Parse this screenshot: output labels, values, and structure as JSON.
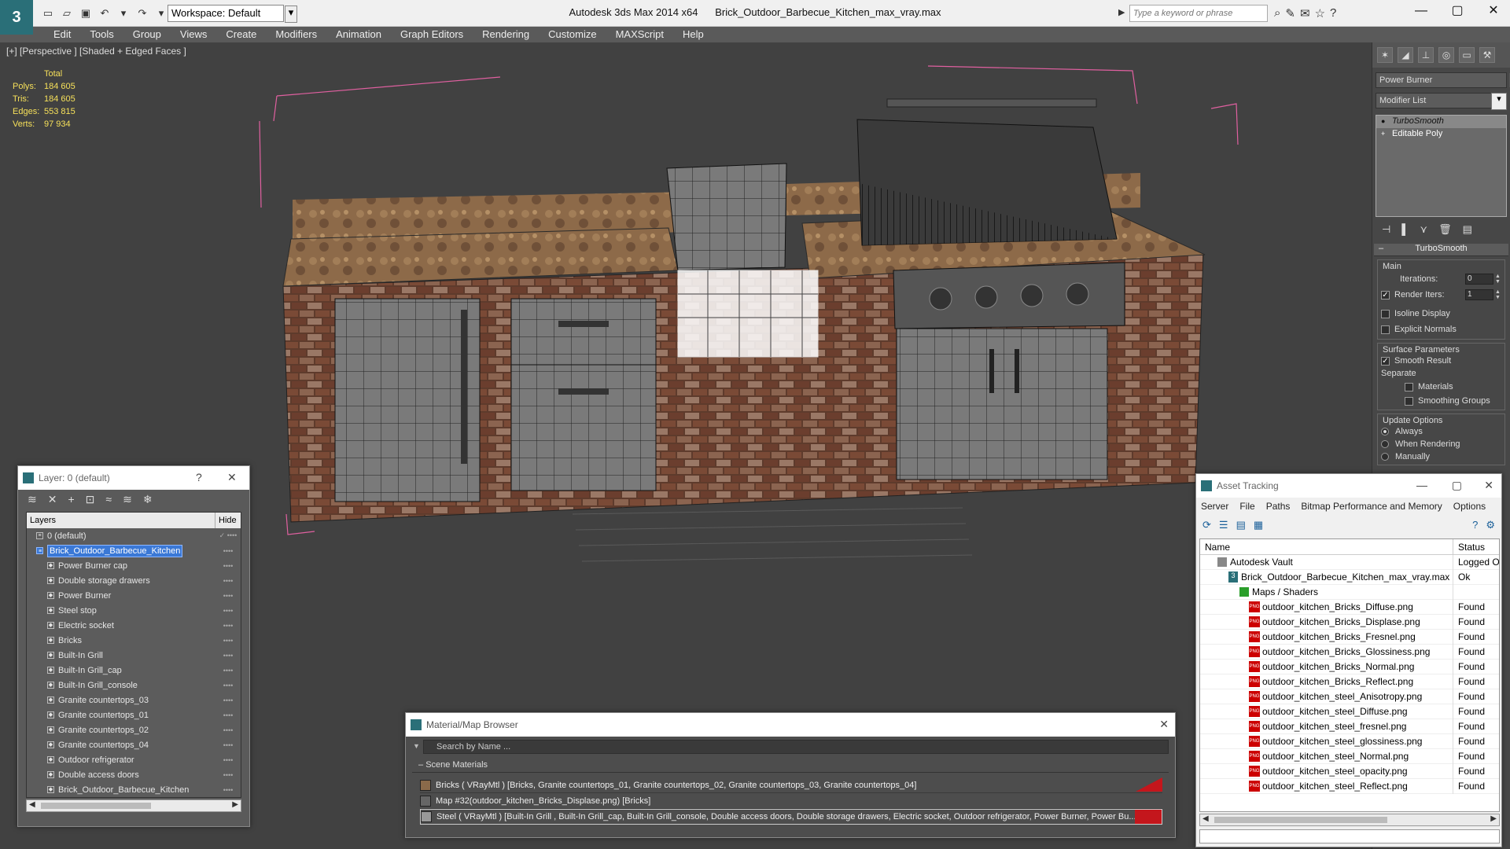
{
  "titlebar": {
    "logo": "3",
    "workspace": "Workspace: Default",
    "app_name": "Autodesk 3ds Max  2014 x64",
    "file_name": "Brick_Outdoor_Barbecue_Kitchen_max_vray.max",
    "search_placeholder": "Type a keyword or phrase"
  },
  "menu": [
    "Edit",
    "Tools",
    "Group",
    "Views",
    "Create",
    "Modifiers",
    "Animation",
    "Graph Editors",
    "Rendering",
    "Customize",
    "MAXScript",
    "Help"
  ],
  "viewport": {
    "label": "[+] [Perspective ] [Shaded + Edged Faces ]",
    "stats": {
      "header": "Total",
      "polys_label": "Polys:",
      "polys": "184 605",
      "tris_label": "Tris:",
      "tris": "184 605",
      "edges_label": "Edges:",
      "edges": "553 815",
      "verts_label": "Verts:",
      "verts": "97 934"
    }
  },
  "command_panel": {
    "object_name": "Power Burner",
    "modifier_list": "Modifier List",
    "stack": [
      "TurboSmooth",
      "Editable Poly"
    ],
    "rollout_title": "TurboSmooth",
    "main_label": "Main",
    "iterations_label": "Iterations:",
    "iterations": "0",
    "render_iters_label": "Render Iters:",
    "render_iters": "1",
    "isoline": "Isoline Display",
    "explicit_normals": "Explicit Normals",
    "surface_params": "Surface Parameters",
    "smooth_result": "Smooth Result",
    "separate": "Separate",
    "materials": "Materials",
    "smoothing_groups": "Smoothing Groups",
    "update_options": "Update Options",
    "always": "Always",
    "when_rendering": "When Rendering",
    "manually": "Manually"
  },
  "layer_window": {
    "title": "Layer: 0 (default)",
    "help": "?",
    "close": "✕",
    "col_layers": "Layers",
    "col_hide": "Hide",
    "rows": [
      {
        "name": "0 (default)",
        "check": "✓"
      },
      {
        "name": "Brick_Outdoor_Barbecue_Kitchen",
        "check": ""
      },
      {
        "name": "Power Burner cap"
      },
      {
        "name": "Double storage drawers"
      },
      {
        "name": "Power Burner"
      },
      {
        "name": "Steel stop"
      },
      {
        "name": "Electric socket"
      },
      {
        "name": "Bricks"
      },
      {
        "name": "Built-In Grill"
      },
      {
        "name": "Built-In Grill_cap"
      },
      {
        "name": "Built-In Grill_console"
      },
      {
        "name": "Granite countertops_03"
      },
      {
        "name": "Granite countertops_01"
      },
      {
        "name": "Granite countertops_02"
      },
      {
        "name": "Granite countertops_04"
      },
      {
        "name": "Outdoor refrigerator"
      },
      {
        "name": "Double access doors"
      },
      {
        "name": "Brick_Outdoor_Barbecue_Kitchen"
      }
    ]
  },
  "material_browser": {
    "title": "Material/Map Browser",
    "close": "✕",
    "search_placeholder": "Search by Name ...",
    "group": "Scene Materials",
    "rows": [
      "Bricks  ( VRayMtl ) [Bricks, Granite countertops_01, Granite countertops_02, Granite countertops_03, Granite countertops_04]",
      "Map #32(outdoor_kitchen_Bricks_Displase.png) [Bricks]",
      "Steel  ( VRayMtl ) [Built-In Grill , Built-In Grill_cap, Built-In Grill_console, Double access doors, Double storage drawers, Electric socket, Outdoor refrigerator, Power Burner, Power Bu..."
    ]
  },
  "asset_tracking": {
    "title": "Asset Tracking",
    "menu": [
      "Server",
      "File",
      "Paths",
      "Bitmap Performance and Memory",
      "Options"
    ],
    "col_name": "Name",
    "col_status": "Status",
    "vault": {
      "name": "Autodesk Vault",
      "status": "Logged O"
    },
    "file": {
      "name": "Brick_Outdoor_Barbecue_Kitchen_max_vray.max",
      "status": "Ok"
    },
    "folder": {
      "name": "Maps / Shaders",
      "status": ""
    },
    "png_label": "PNG",
    "files": [
      {
        "name": "outdoor_kitchen_Bricks_Diffuse.png",
        "status": "Found"
      },
      {
        "name": "outdoor_kitchen_Bricks_Displase.png",
        "status": "Found"
      },
      {
        "name": "outdoor_kitchen_Bricks_Fresnel.png",
        "status": "Found"
      },
      {
        "name": "outdoor_kitchen_Bricks_Glossiness.png",
        "status": "Found"
      },
      {
        "name": "outdoor_kitchen_Bricks_Normal.png",
        "status": "Found"
      },
      {
        "name": "outdoor_kitchen_Bricks_Reflect.png",
        "status": "Found"
      },
      {
        "name": "outdoor_kitchen_steel_Anisotropy.png",
        "status": "Found"
      },
      {
        "name": "outdoor_kitchen_steel_Diffuse.png",
        "status": "Found"
      },
      {
        "name": "outdoor_kitchen_steel_fresnel.png",
        "status": "Found"
      },
      {
        "name": "outdoor_kitchen_steel_glossiness.png",
        "status": "Found"
      },
      {
        "name": "outdoor_kitchen_steel_Normal.png",
        "status": "Found"
      },
      {
        "name": "outdoor_kitchen_steel_opacity.png",
        "status": "Found"
      },
      {
        "name": "outdoor_kitchen_steel_Reflect.png",
        "status": "Found"
      }
    ]
  },
  "colors": {
    "selection": "#3a78d6",
    "stats": "#f6e05a",
    "bbox": "#e060a0",
    "accent": "#2a6f78"
  }
}
